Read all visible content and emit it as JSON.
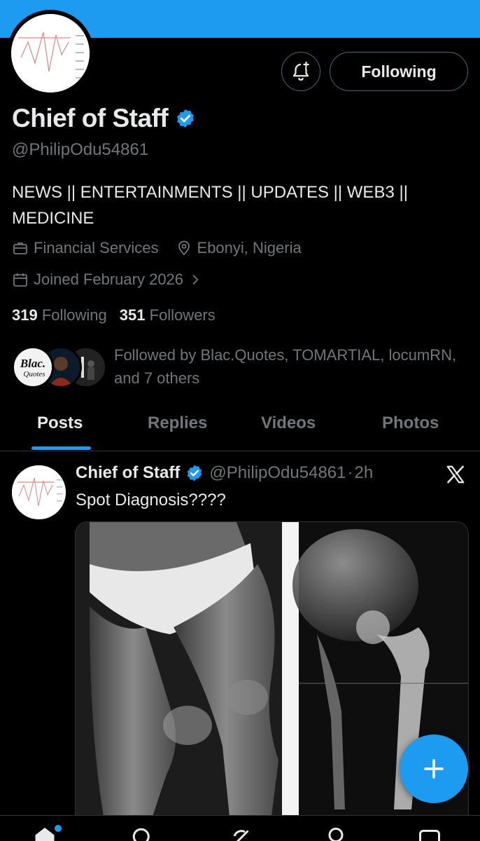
{
  "profile": {
    "name": "Chief of Staff",
    "handle": "@PhilipOdu54861",
    "bio": "NEWS || ENTERTAINMENTS || UPDATES || WEB3 || MEDICINE",
    "category": "Financial Services",
    "location": "Ebonyi, Nigeria",
    "joined": "Joined February 2026",
    "following_count": "319",
    "following_label": "Following",
    "followers_count": "351",
    "followers_label": "Followers",
    "followed_by": "Followed by Blac.Quotes, TOMARTIAL, locumRN, and 7 others",
    "follow_button_label": "Following"
  },
  "followed_avatar_text": {
    "blac": "Blac.",
    "quotes": "Quotes"
  },
  "tabs": [
    {
      "label": "Posts",
      "active": true
    },
    {
      "label": "Replies",
      "active": false
    },
    {
      "label": "Videos",
      "active": false
    },
    {
      "label": "Photos",
      "active": false
    }
  ],
  "post": {
    "author": "Chief of Staff",
    "handle": "@PhilipOdu54861",
    "separator": "·",
    "time": "2h",
    "text": "Spot Diagnosis????"
  },
  "colors": {
    "accent": "#1d9bf0",
    "background": "#000000",
    "secondary_text": "#71767b"
  },
  "icons": {
    "notify": "bell-plus-icon",
    "verified": "verified-badge-icon",
    "category": "briefcase-icon",
    "location": "location-pin-icon",
    "joined": "calendar-icon",
    "chevron": "chevron-right-icon",
    "compose": "plus-icon",
    "more": "x-logo-icon"
  },
  "nav": [
    "home-icon",
    "search-icon",
    "grok-icon",
    "communities-icon",
    "messages-icon"
  ]
}
